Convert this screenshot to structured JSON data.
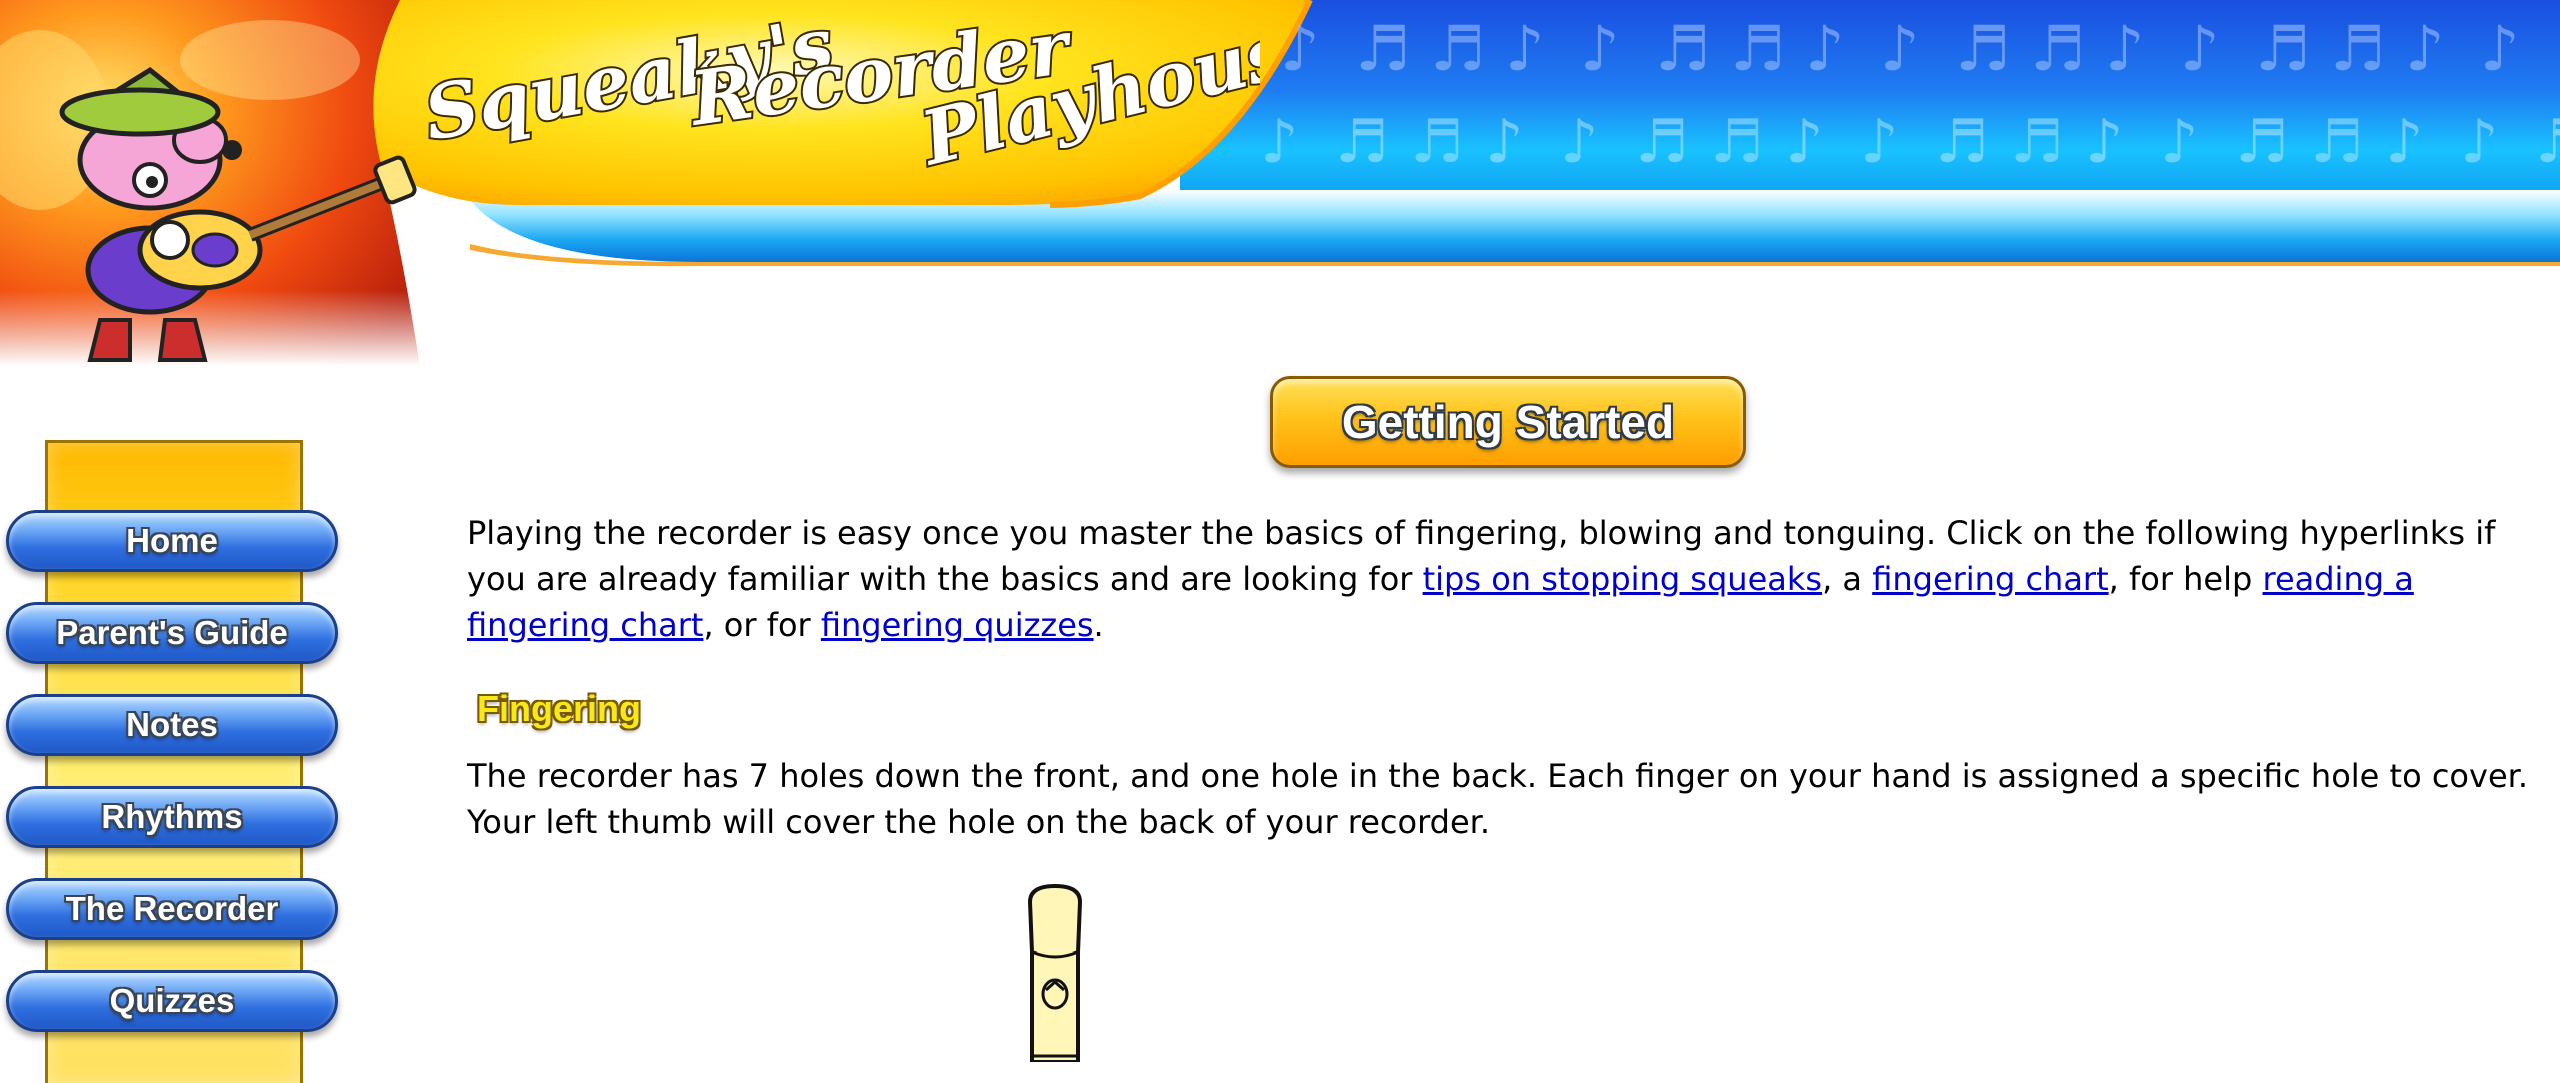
{
  "header": {
    "title_line1": "Squeaky's",
    "title_line2": "Recorder",
    "title_line3": "Playhouse",
    "note_glyphs": [
      "♪",
      "♬"
    ]
  },
  "sidebar": {
    "items": [
      {
        "label": "Home"
      },
      {
        "label": "Parent's Guide"
      },
      {
        "label": "Notes"
      },
      {
        "label": "Rhythms"
      },
      {
        "label": "The Recorder"
      },
      {
        "label": "Quizzes"
      }
    ]
  },
  "main": {
    "section_button": "Getting Started",
    "intro": {
      "text1": "Playing the recorder is easy once you master the basics of fingering, blowing and tonguing.  Click on the following hyperlinks if you are already familiar with the basics and are looking for ",
      "link1": "tips on stopping squeaks",
      "text2": ", a ",
      "link2": "fingering chart",
      "text3": ", for help ",
      "link3": "reading a fingering chart",
      "text4": ", or for ",
      "link4": "fingering quizzes",
      "text5": "."
    },
    "fingering_heading": "Fingering",
    "fingering_text": "The recorder has 7 holes down the front, and one hole in the back.  Each finger on your hand is assigned a specific hole to cover.  Your left thumb will cover the hole on the back of your recorder."
  },
  "colors": {
    "nav_blue": "#2f6fe0",
    "banner_blue": "#1e5fe8",
    "banner_cyan": "#19b6ff",
    "banner_yellow": "#ffe21a",
    "banner_orange": "#ff8a00",
    "link": "#0000cc",
    "heading_yellow": "#f6e81a"
  }
}
